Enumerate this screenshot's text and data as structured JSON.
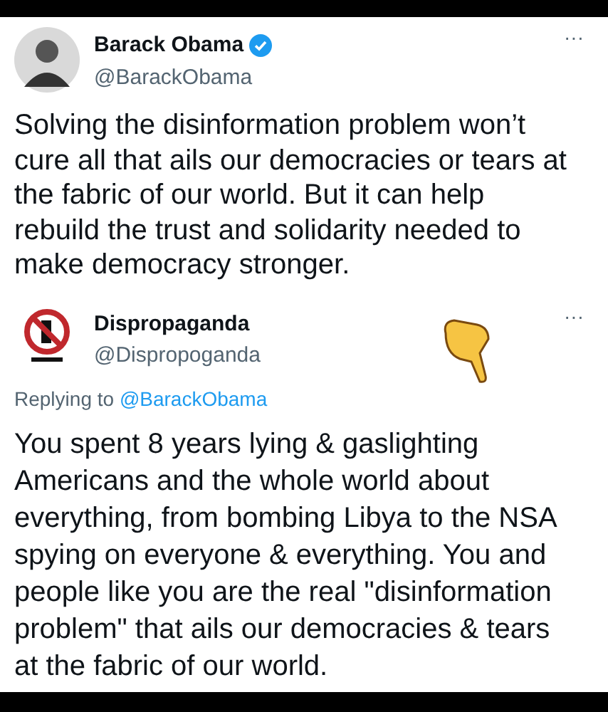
{
  "tweets": [
    {
      "name": "Barack Obama",
      "handle": "@BarackObama",
      "verified": true,
      "avatar": {
        "kind": "person"
      },
      "text": "Solving the disinformation problem won’t cure all that ails our democracies or tears at the fabric of our world. But it can help rebuild the trust and solidarity needed to make democracy stronger.",
      "more": "···"
    },
    {
      "name": "Dispropaganda",
      "handle": "@Dispropoganda",
      "verified": false,
      "avatar": {
        "kind": "prohibition"
      },
      "replying_label": "Replying to",
      "replying_to": "@BarackObama",
      "text": "You spent 8 years lying & gaslighting Americans and the whole world about everything, from bombing Libya to the NSA spying on everyone & everything. You and people like you are the real \"disinformation problem\" that ails our democracies & tears at the fabric of our world.",
      "more": "···"
    }
  ]
}
